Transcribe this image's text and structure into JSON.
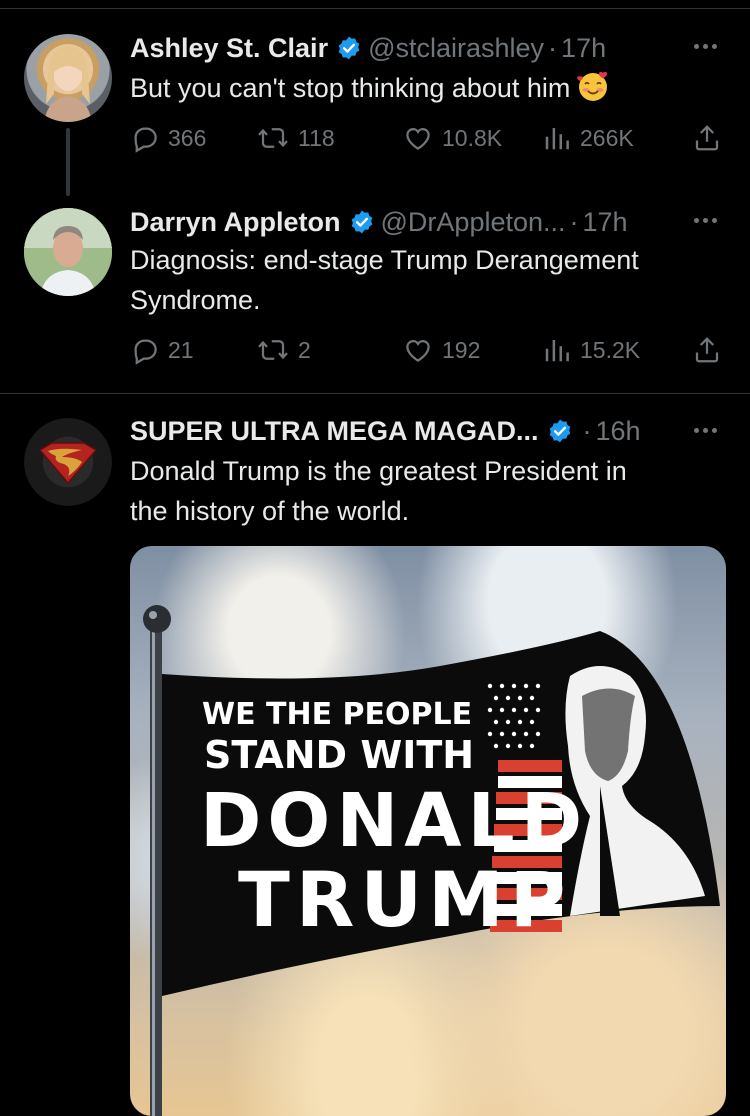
{
  "tweets": [
    {
      "name": "Ashley St. Clair",
      "handle": "@stclairashley",
      "time": "17h",
      "text": "But you can't stop thinking about him",
      "emoji": "smiling-face-with-hearts",
      "replies": "366",
      "retweets": "118",
      "likes": "10.8K",
      "views": "266K"
    },
    {
      "name": "Darryn Appleton",
      "handle": "@DrAppleton...",
      "time": "17h",
      "text_line1": "Diagnosis: end-stage Trump Derangement",
      "text_line2": "Syndrome.",
      "replies": "21",
      "retweets": "2",
      "likes": "192",
      "views": "15.2K"
    },
    {
      "name": "SUPER ULTRA MEGA MAGAD...",
      "time": "16h",
      "text_line1": "Donald Trump is the greatest President in",
      "text_line2": "the history of the world.",
      "flag": {
        "line1": "WE THE PEOPLE",
        "line2": "STAND WITH",
        "line3": "DONALD",
        "line4": "TRUMP"
      }
    }
  ],
  "separator": "·",
  "colors": {
    "background": "#000000",
    "text": "#e7e9ea",
    "muted": "#71767b",
    "verified": "#1d9bf0",
    "divider": "#2f3336"
  }
}
